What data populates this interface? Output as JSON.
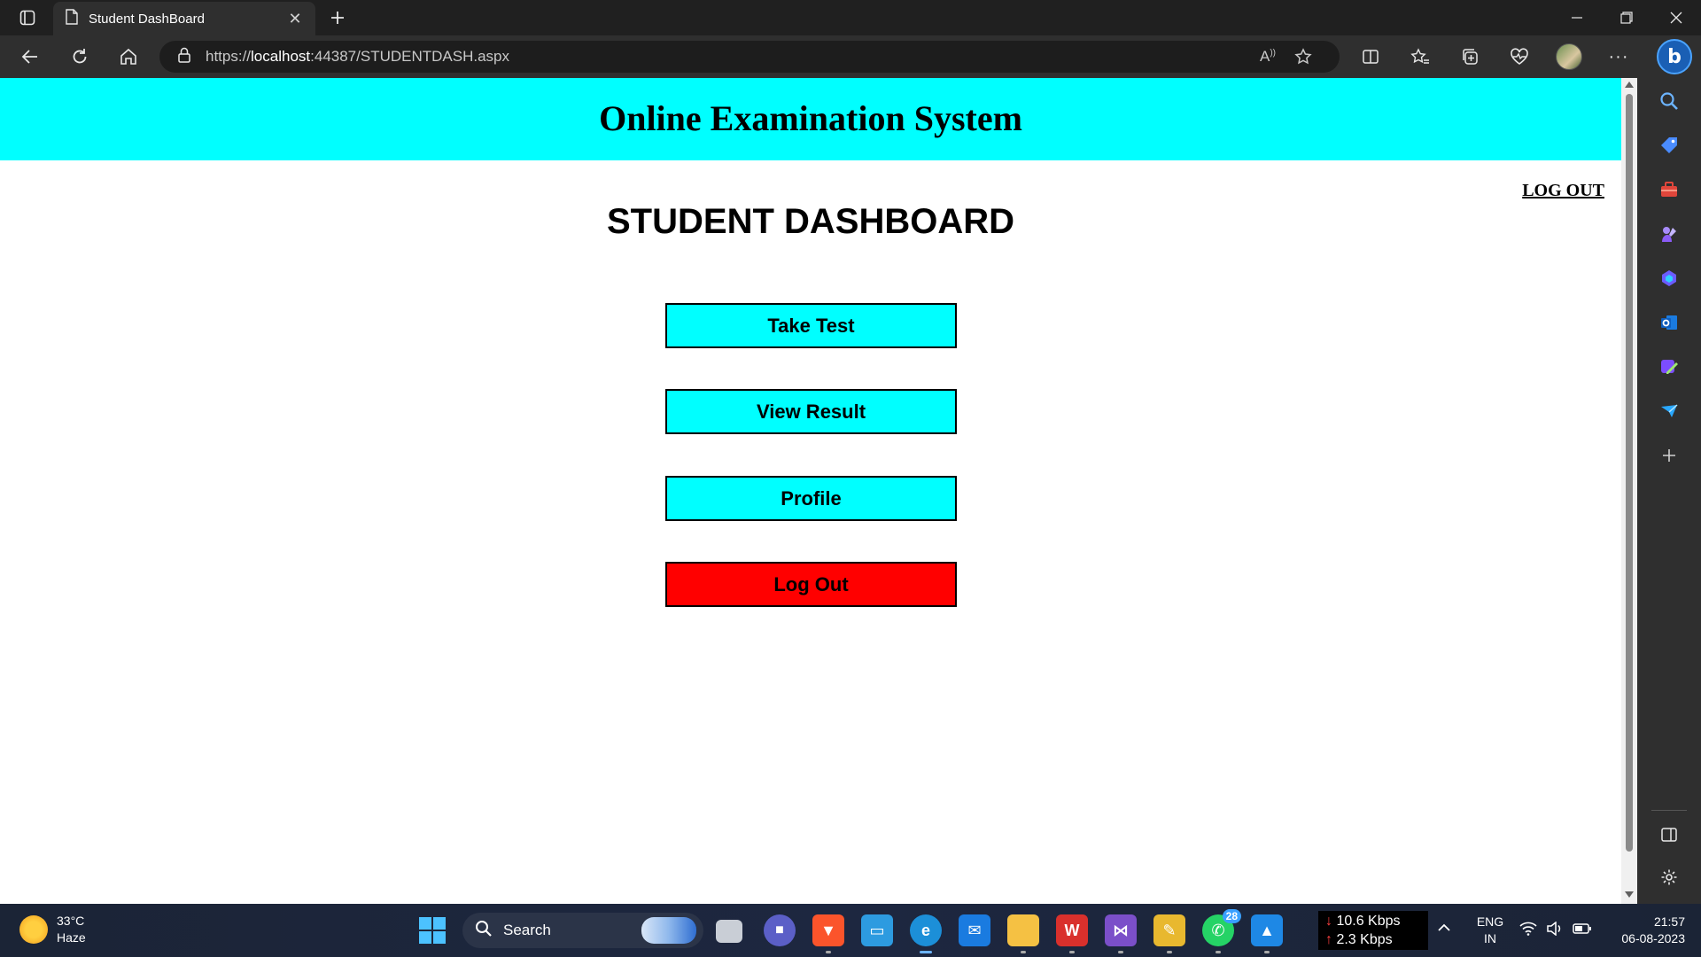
{
  "browser": {
    "tab_title": "Student DashBoard",
    "url_prefix": "https://",
    "url_host": "localhost",
    "url_rest": ":44387/STUDENTDASH.aspx"
  },
  "page": {
    "site_title": "Online Examination System",
    "logout_link": "LOG OUT",
    "dashboard_title": "STUDENT DASHBOARD",
    "buttons": [
      {
        "label": "Take Test"
      },
      {
        "label": "View Result"
      },
      {
        "label": "Profile"
      },
      {
        "label": "Log Out"
      }
    ],
    "colors": {
      "header_bg": "#00ffff",
      "button_bg": "#00ffff",
      "logout_button_bg": "#ff0000"
    }
  },
  "taskbar": {
    "weather_temp": "33°C",
    "weather_desc": "Haze",
    "search_label": "Search",
    "whatsapp_badge": "28",
    "net_down": "10.6 Kbps",
    "net_up": "2.3 Kbps",
    "lang_1": "ENG",
    "lang_2": "IN",
    "time": "21:57",
    "date": "06-08-2023"
  }
}
